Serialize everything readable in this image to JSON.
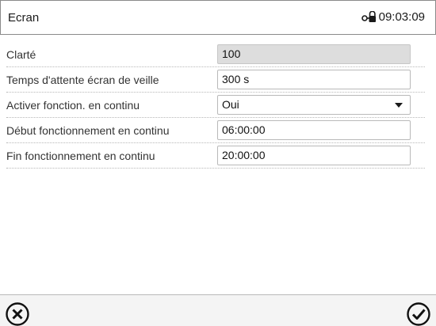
{
  "header": {
    "title": "Ecran",
    "time": "09:03:09",
    "lock_icon": "padlock-key-icon"
  },
  "settings": [
    {
      "label": "Clarté",
      "value": "100",
      "kind": "readonly"
    },
    {
      "label": "Temps d'attente écran de veille",
      "value": "300 s",
      "kind": "input"
    },
    {
      "label": "Activer fonction. en continu",
      "value": "Oui",
      "kind": "dropdown"
    },
    {
      "label": "Début fonctionnement en continu",
      "value": "06:00:00",
      "kind": "input"
    },
    {
      "label": "Fin fonctionnement en continu",
      "value": "20:00:00",
      "kind": "input"
    }
  ],
  "footer": {
    "cancel_icon": "cancel-circle-x-icon",
    "confirm_icon": "confirm-circle-check-icon"
  },
  "colors": {
    "border": "#8a8a8a",
    "readonly_fill": "#dddddd",
    "footer_bg": "#f4f4f4"
  }
}
